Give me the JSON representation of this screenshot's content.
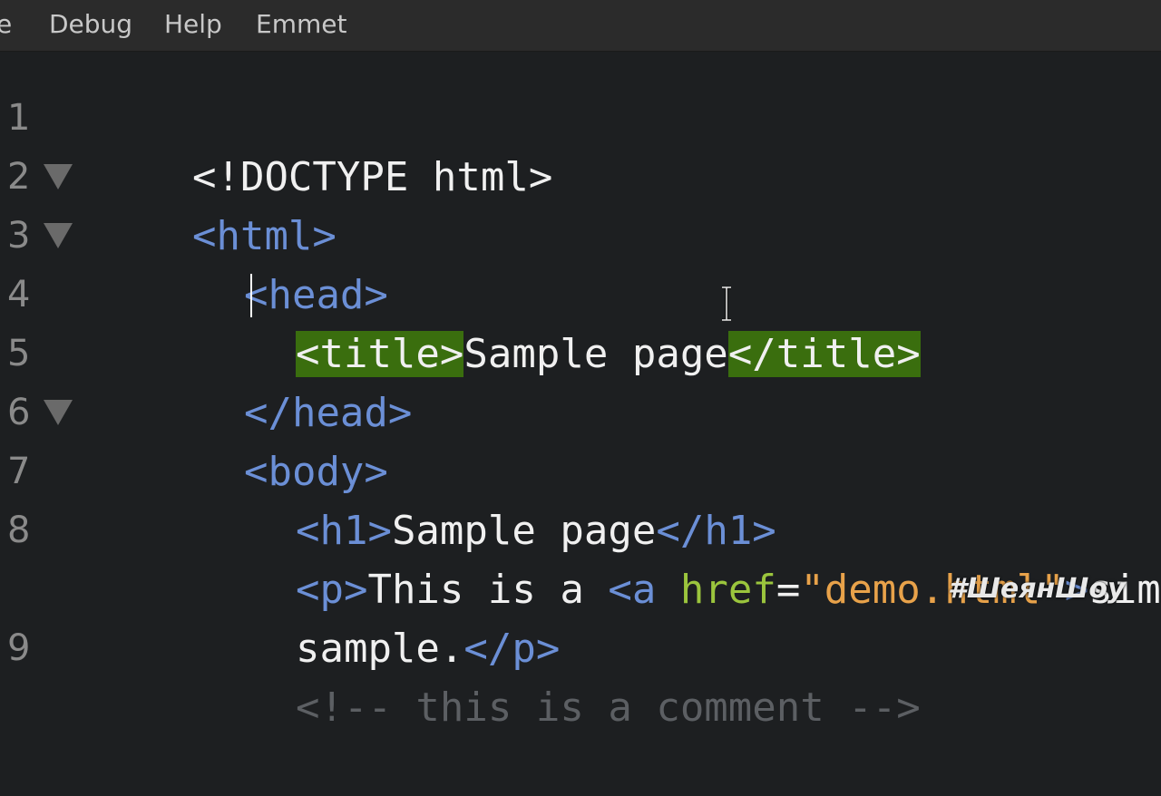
{
  "menu": {
    "items": [
      {
        "label": "e"
      },
      {
        "label": "Debug"
      },
      {
        "label": "Help"
      },
      {
        "label": "Emmet"
      }
    ]
  },
  "editor": {
    "line_numbers": [
      "1",
      "2",
      "3",
      "4",
      "5",
      "6",
      "7",
      "8",
      "9"
    ],
    "lines": {
      "l1": "<!DOCTYPE html>",
      "l2": "<html>",
      "l3": "<head>",
      "l4_open": "<title>",
      "l4_text": "Sample page",
      "l4_close": "</title>",
      "l5": "</head>",
      "l6": "<body>",
      "l7_open": "<h1>",
      "l7_text": "Sample page",
      "l7_close": "</h1>",
      "l8_popen": "<p>",
      "l8_text": "This is a ",
      "l8_aopen": "<a ",
      "l8_attr": "href",
      "l8_eq": "=",
      "l8_val": "\"demo.html\"",
      "l8_gt": ">",
      "l8_link": "simp",
      "l8b_text": "sample.",
      "l8b_pclose": "</p>",
      "l9": "<!-- this is a comment -->"
    },
    "colors": {
      "tag": "#6b8fd6",
      "attribute": "#9bc53d",
      "string": "#e8a24a",
      "match_highlight": "#3a6e0e"
    }
  },
  "watermark": "#ШеянШоу"
}
